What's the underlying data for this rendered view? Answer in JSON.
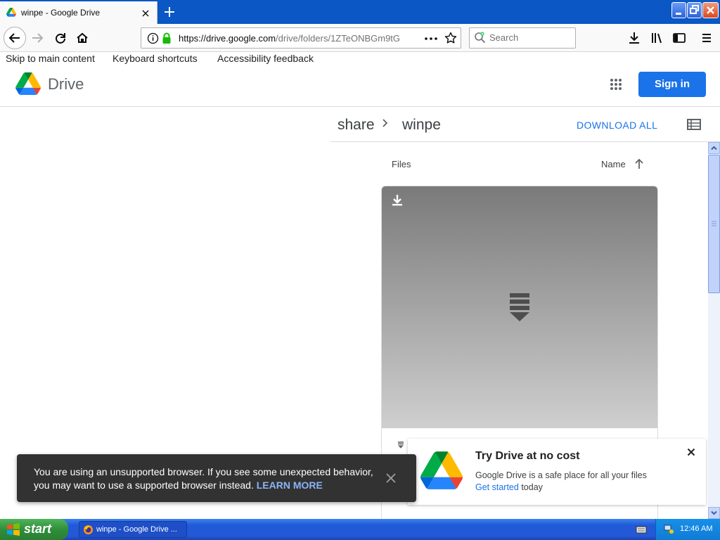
{
  "browser": {
    "tab_title": "winpe - Google Drive",
    "url_host": "https://drive.google.com",
    "url_path": "/drive/folders/1ZTeONBGm9tG",
    "search_placeholder": "Search"
  },
  "skip_links": [
    "Skip to main content",
    "Keyboard shortcuts",
    "Accessibility feedback"
  ],
  "drive_header": {
    "product_name": "Drive",
    "signin_label": "Sign in"
  },
  "toolbar": {
    "breadcrumb_parent": "share",
    "breadcrumb_current": "winpe",
    "download_all_label": "DOWNLOAD ALL"
  },
  "files": {
    "section_label": "Files",
    "sort_label": "Name"
  },
  "promo": {
    "title": "Try Drive at no cost",
    "description": "Google Drive is a safe place for all your files",
    "link_label": "Get started",
    "link_suffix": " today"
  },
  "snackbar": {
    "message": "You are using an unsupported browser. If you see some unexpected behavior, you may want to use a supported browser instead.",
    "action_label": "LEARN MORE"
  },
  "taskbar": {
    "start_label": "start",
    "task_label": "winpe - Google Drive ...",
    "clock": "12:46 AM"
  },
  "colors": {
    "accent": "#1a73e8",
    "snackbar_bg": "#323232",
    "taskbar_blue": "#2459d6",
    "start_green": "#2f8f3a"
  }
}
